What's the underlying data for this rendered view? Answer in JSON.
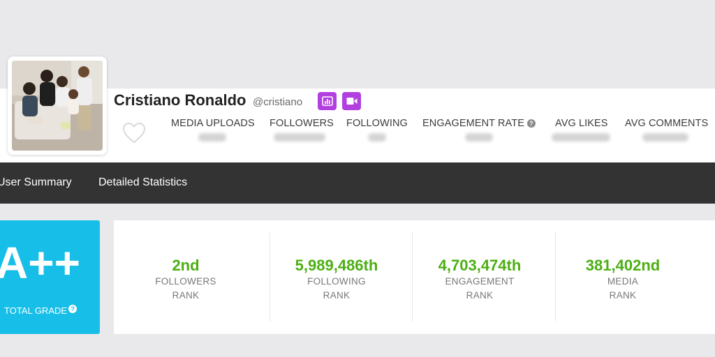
{
  "profile": {
    "name": "Cristiano Ronaldo",
    "handle": "@cristiano"
  },
  "badges": [
    {
      "icon": "bar-chart-icon",
      "color": "#b23fe0"
    },
    {
      "icon": "video-camera-icon",
      "color": "#b23fe0"
    }
  ],
  "stats": {
    "media_uploads": "MEDIA UPLOADS",
    "followers": "FOLLOWERS",
    "following": "FOLLOWING",
    "engagement_rate": "ENGAGEMENT RATE",
    "avg_likes": "AVG LIKES",
    "avg_comments": "AVG COMMENTS"
  },
  "nav": {
    "user_summary": "User Summary",
    "detailed_statistics": "Detailed Statistics"
  },
  "grade": {
    "value": "A++",
    "label": "TOTAL GRADE",
    "color": "#17bfe8"
  },
  "ranks": [
    {
      "value": "2nd",
      "label1": "FOLLOWERS",
      "label2": "RANK"
    },
    {
      "value": "5,989,486th",
      "label1": "FOLLOWING",
      "label2": "RANK"
    },
    {
      "value": "4,703,474th",
      "label1": "ENGAGEMENT",
      "label2": "RANK"
    },
    {
      "value": "381,402nd",
      "label1": "MEDIA",
      "label2": "RANK"
    }
  ],
  "colors": {
    "rank_green": "#4caf12",
    "navbar": "#333333",
    "badge_purple": "#b23fe0"
  }
}
